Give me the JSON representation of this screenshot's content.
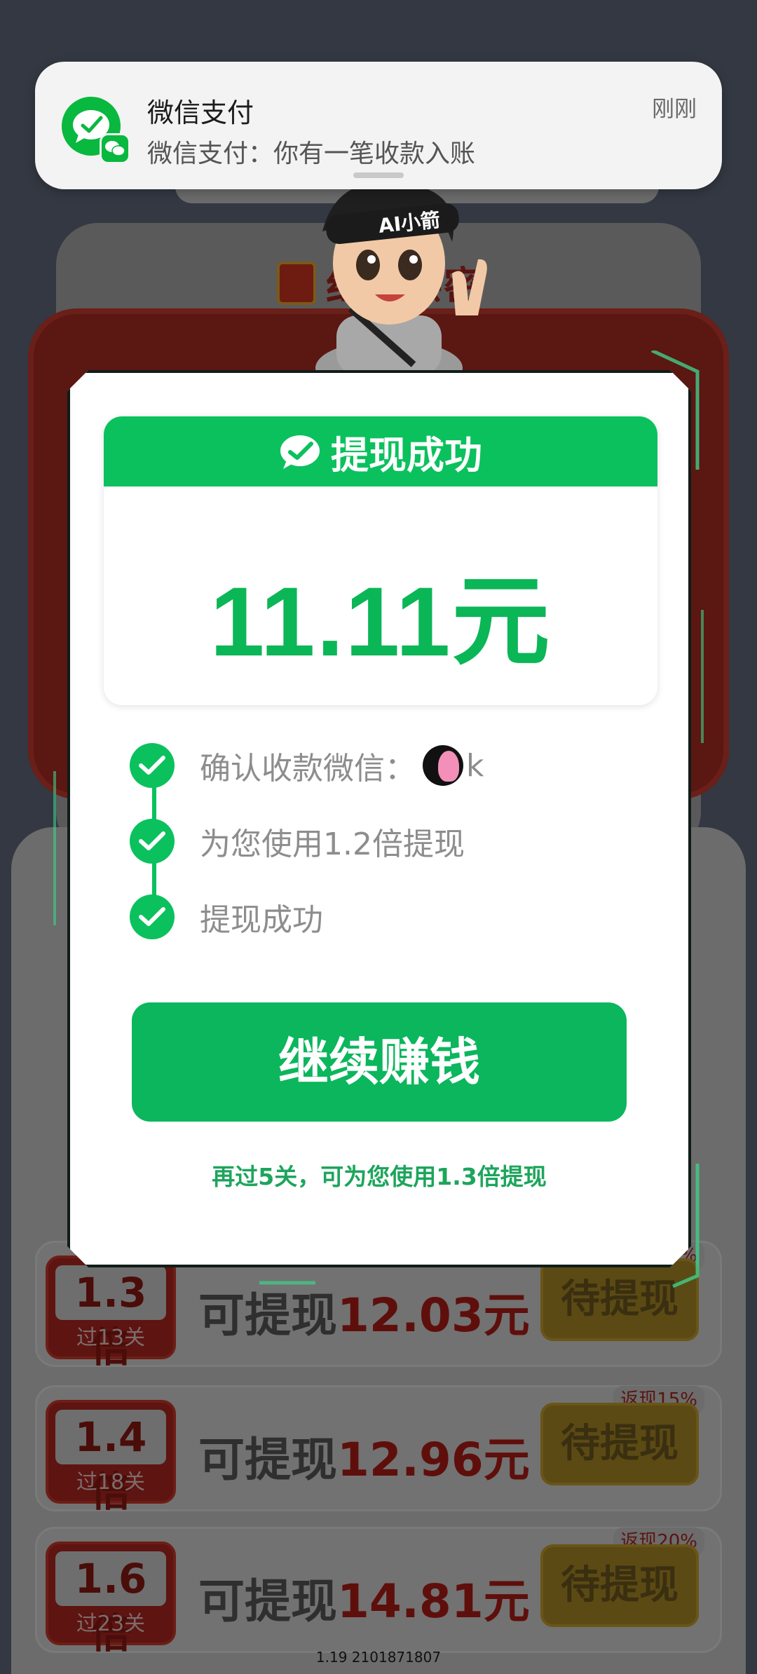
{
  "notification": {
    "app": "微信支付",
    "message": "微信支付：你有一笔收款入账",
    "time": "刚刚"
  },
  "background": {
    "panel_title": "红包亲密",
    "rows": [
      {
        "multiplier": "1.3倍",
        "level": "过13关",
        "label": "可提现",
        "amount": "12.03元",
        "button": "待提现",
        "rebate": "返现10%"
      },
      {
        "multiplier": "1.4倍",
        "level": "过18关",
        "label": "可提现",
        "amount": "12.96元",
        "button": "待提现",
        "rebate": "返现15%"
      },
      {
        "multiplier": "1.6倍",
        "level": "过23关",
        "label": "可提现",
        "amount": "14.81元",
        "button": "待提现",
        "rebate": "返现20%"
      }
    ],
    "footer": "1.19 2101871807"
  },
  "mascot": {
    "headband_text": "AI小箭"
  },
  "modal": {
    "header": "提现成功",
    "amount": "11.11元",
    "steps": [
      {
        "text": "确认收款微信：",
        "suffix": "k"
      },
      {
        "text": "为您使用1.2倍提现"
      },
      {
        "text": "提现成功"
      }
    ],
    "cta": "继续赚钱",
    "hint": "再过5关，可为您使用1.3倍提现"
  },
  "colors": {
    "wechat_green": "#0bc15d",
    "amount_green": "#0bb657",
    "hint_green": "#1da55c"
  }
}
